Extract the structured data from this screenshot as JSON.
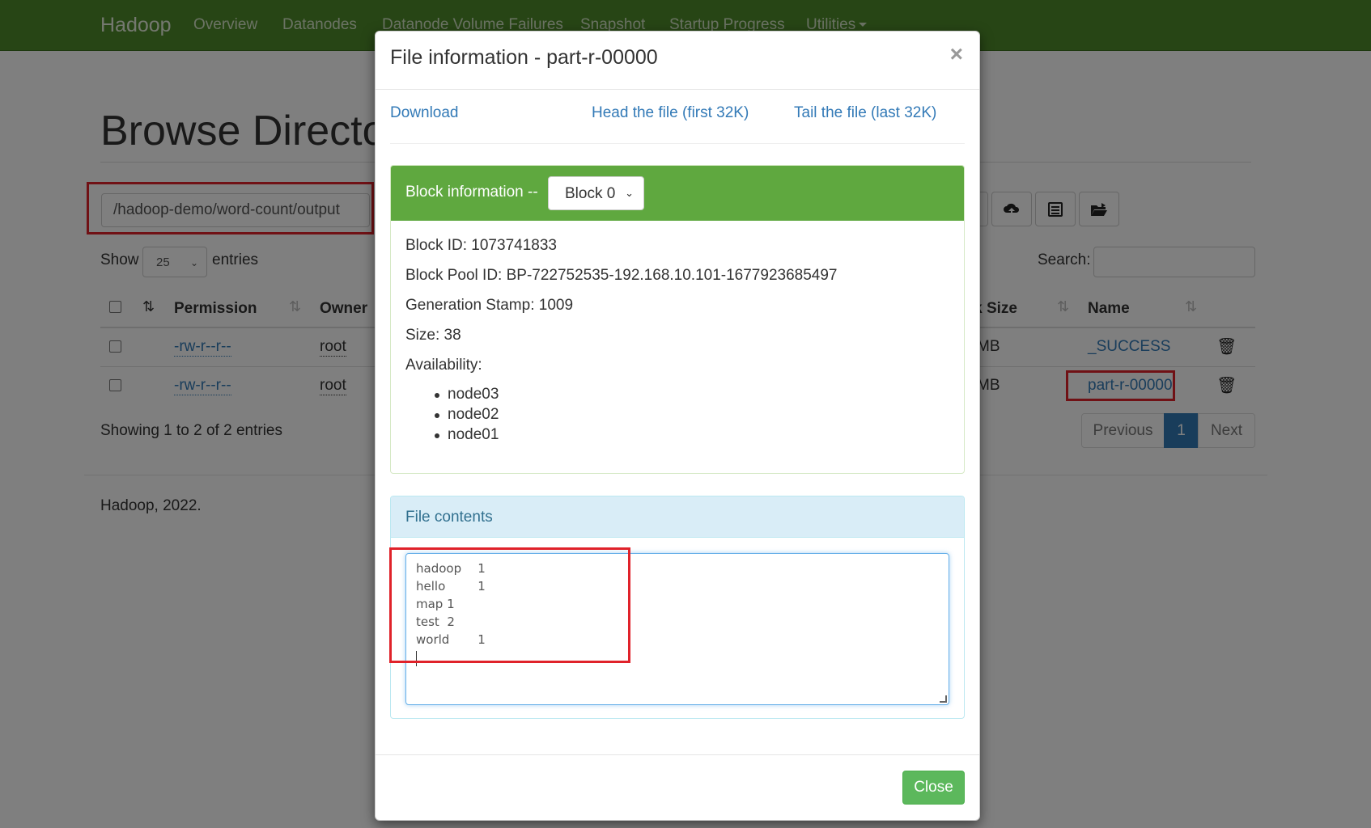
{
  "navbar": {
    "brand": "Hadoop",
    "items": [
      {
        "label": "Overview"
      },
      {
        "label": "Datanodes"
      },
      {
        "label": "Datanode Volume Failures"
      },
      {
        "label": "Snapshot"
      },
      {
        "label": "Startup Progress"
      },
      {
        "label": "Utilities"
      }
    ]
  },
  "page": {
    "title": "Browse Directory",
    "path": "/hadoop-demo/word-count/output",
    "show_label": "Show",
    "page_size": "25",
    "entries_label": "entries",
    "search_label": "Search:",
    "search_value": "",
    "toolbar_icons": [
      "folder-open-icon",
      "cloud-upload-icon",
      "list-alt-icon",
      "folder-share-icon"
    ],
    "columns": {
      "permission": "Permission",
      "owner": "Owner",
      "block_size": "Block Size",
      "name": "Name"
    },
    "rows": [
      {
        "permission": "-rw-r--r--",
        "owner": "root",
        "size_fragment": "MB",
        "name": "_SUCCESS"
      },
      {
        "permission": "-rw-r--r--",
        "owner": "root",
        "size_fragment": "MB",
        "name": "part-r-00000"
      }
    ],
    "showing": "Showing 1 to 2 of 2 entries",
    "pagination": {
      "previous": "Previous",
      "current": "1",
      "next": "Next"
    },
    "footer": "Hadoop, 2022."
  },
  "modal": {
    "title": "File information - part-r-00000",
    "close_x": "×",
    "links": {
      "download": "Download",
      "head": "Head the file (first 32K)",
      "tail": "Tail the file (last 32K)"
    },
    "block_panel": {
      "heading": "Block information --",
      "selected_block": "Block 0",
      "block_id": "Block ID: 1073741833",
      "block_pool_id": "Block Pool ID: BP-722752535-192.168.10.101-1677923685497",
      "generation_stamp": "Generation Stamp: 1009",
      "size": "Size: 38",
      "availability_label": "Availability:",
      "availability": [
        "node03",
        "node02",
        "node01"
      ]
    },
    "contents_panel": {
      "heading": "File contents",
      "lines": [
        "hadoop\t1",
        "hello\t1",
        "map 1",
        "test  2",
        "world\t1"
      ]
    },
    "close_button": "Close"
  },
  "colors": {
    "navbar": "#4f8a2a",
    "block_header": "#5fa83f",
    "link": "#337ab7",
    "close_button": "#5cb85c",
    "highlight_box": "#e0222a",
    "pagination_active": "#337ab7"
  }
}
